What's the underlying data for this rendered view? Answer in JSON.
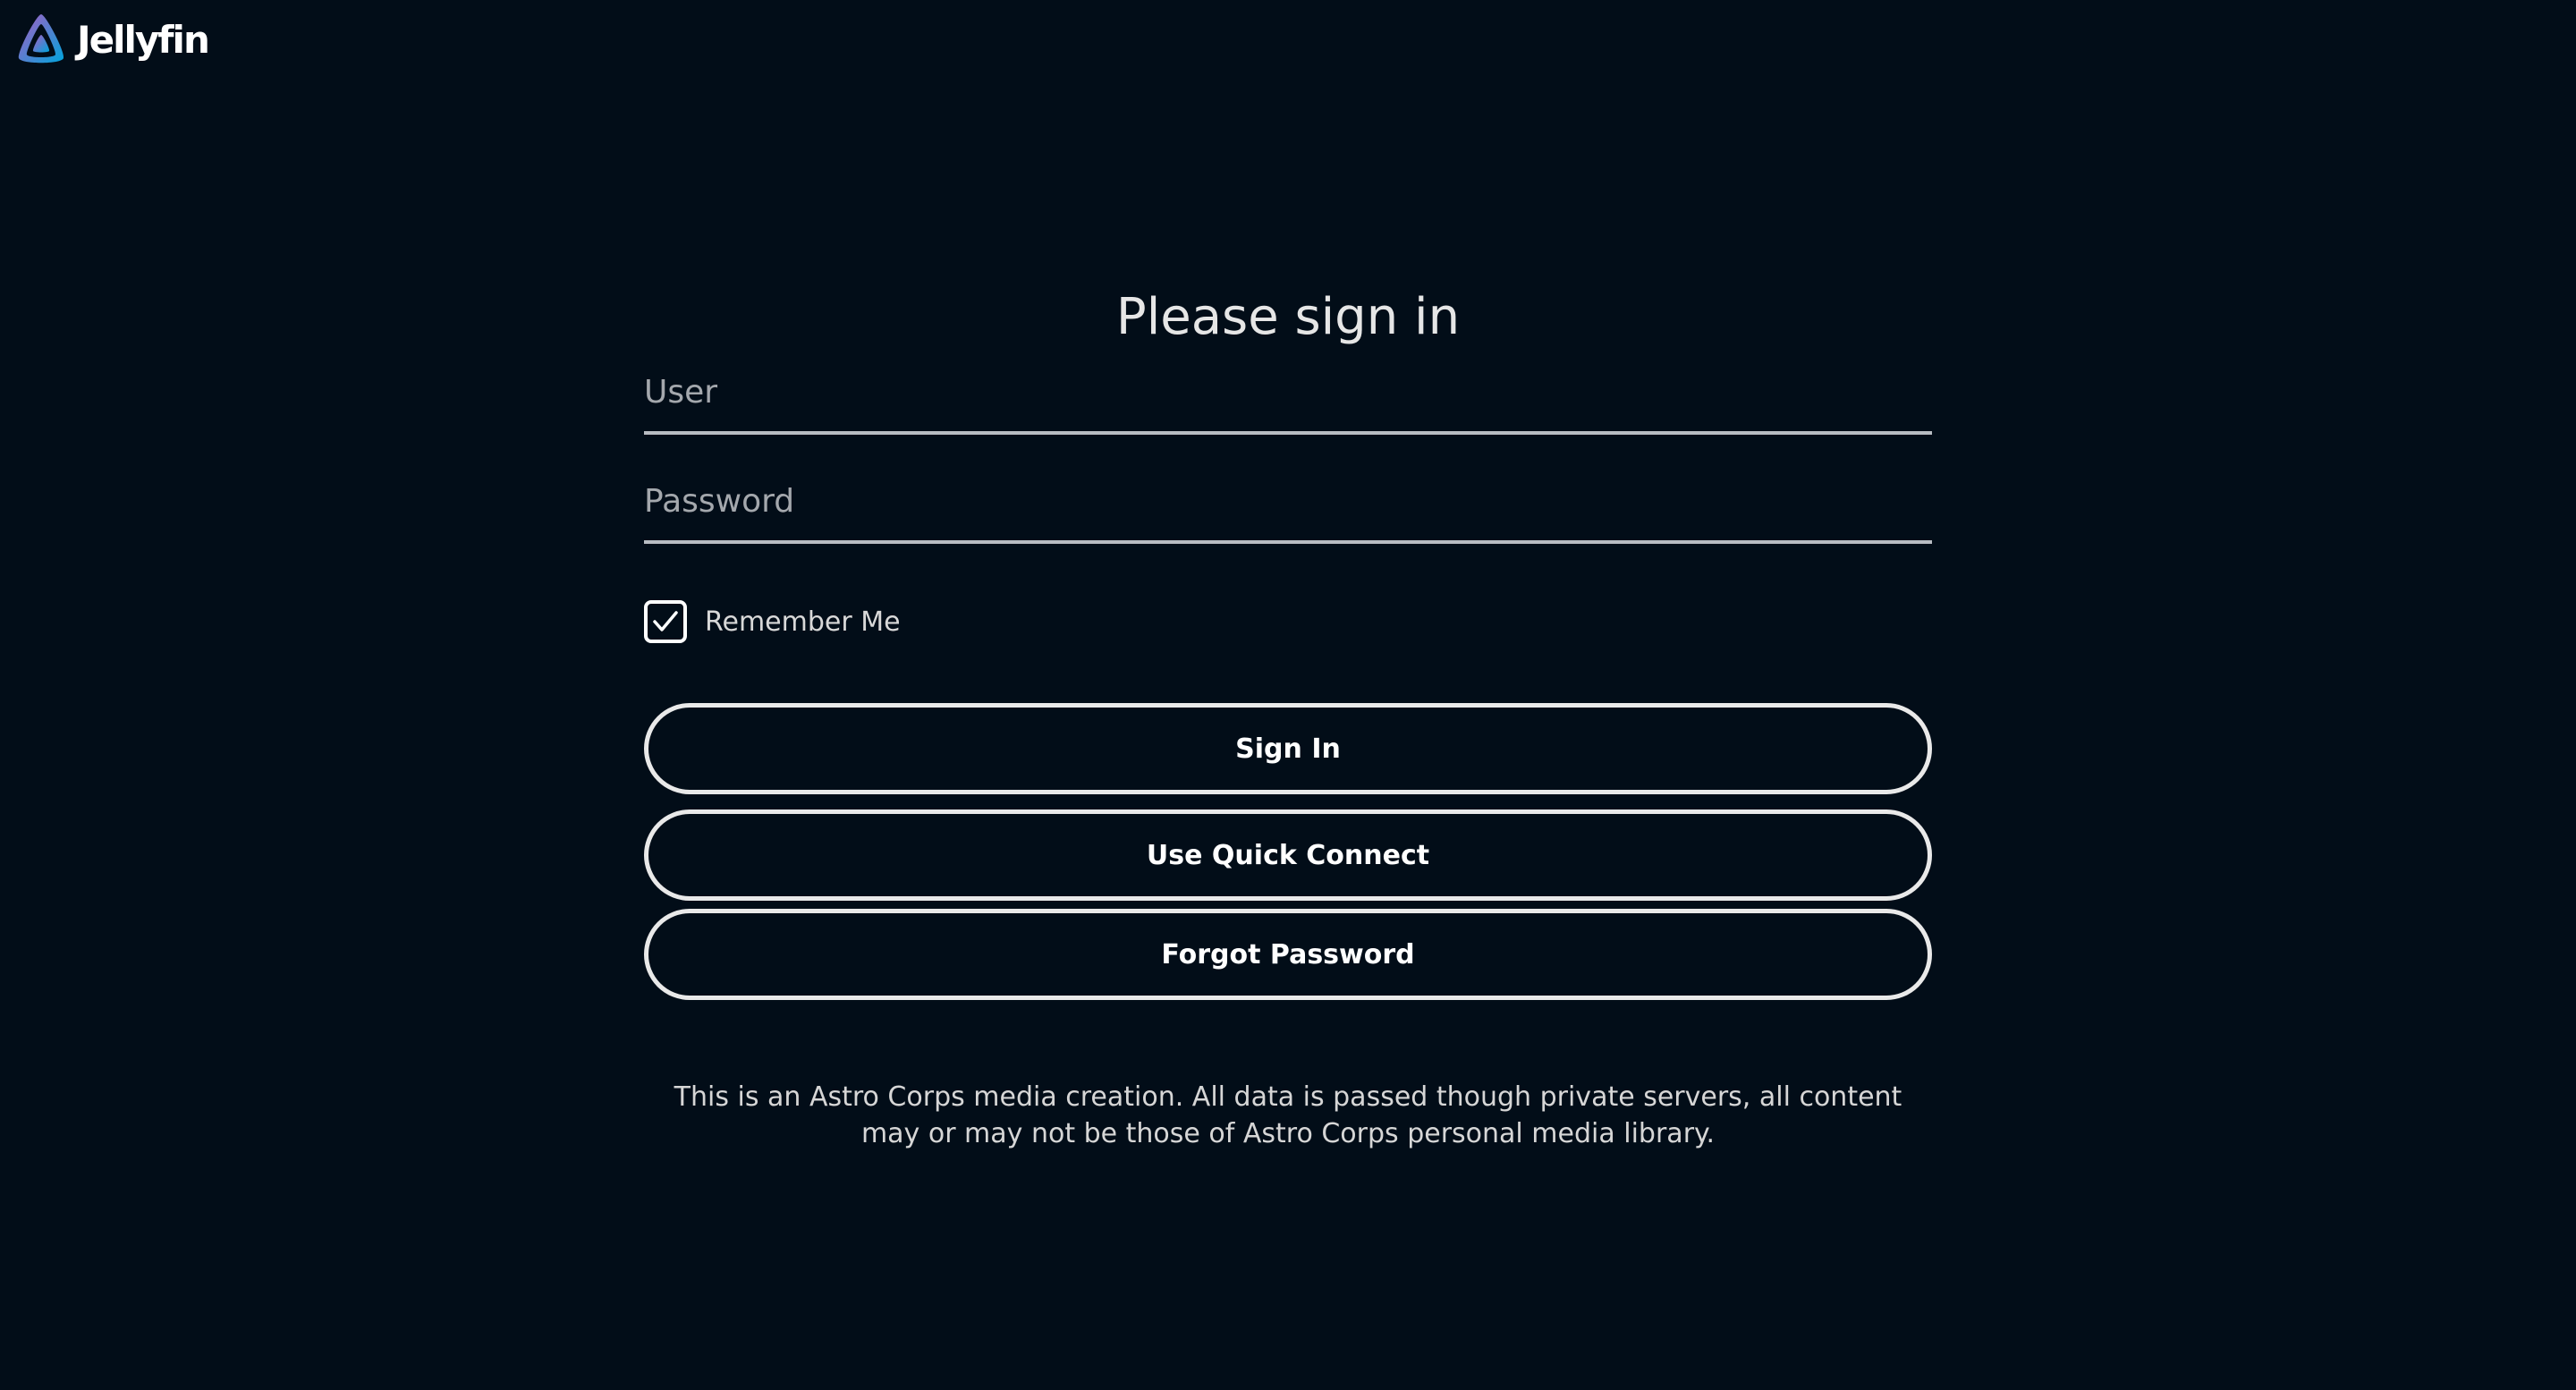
{
  "app": {
    "name": "Jellyfin"
  },
  "login": {
    "title": "Please sign in",
    "user_placeholder": "User",
    "user_value": "",
    "password_placeholder": "Password",
    "password_value": "",
    "remember_label": "Remember Me",
    "remember_checked": true,
    "sign_in_label": "Sign In",
    "quick_connect_label": "Use Quick Connect",
    "forgot_password_label": "Forgot Password",
    "disclaimer": "This is an Astro Corps media creation. All data is passed though private servers, all content may or may not be those of Astro Corps personal media library."
  },
  "icons": {
    "logo": "jellyfin-logo-icon",
    "checkbox": "checkmark-icon"
  },
  "colors": {
    "background": "#020d18",
    "text": "#ffffff",
    "logo_gradient_start": "#aa5cc3",
    "logo_gradient_end": "#00a4dc"
  }
}
